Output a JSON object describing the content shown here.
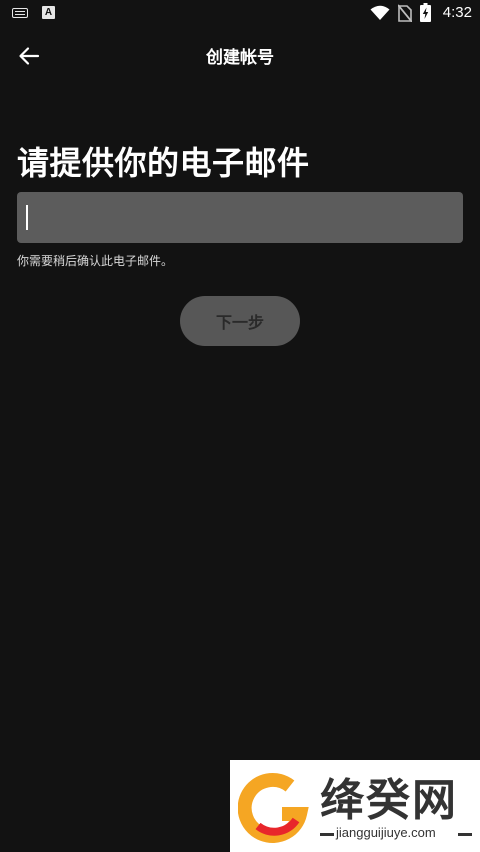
{
  "status_bar": {
    "time": "4:32",
    "left_icons": [
      "keyboard-icon",
      "a-notification-icon"
    ],
    "right_icons": [
      "wifi-icon",
      "no-sim-icon",
      "battery-charging-icon"
    ]
  },
  "app_bar": {
    "back_icon": "arrow-left-icon",
    "title": "创建帐号"
  },
  "form": {
    "heading": "请提供你的电子邮件",
    "email_value": "",
    "hint": "你需要稍后确认此电子邮件。",
    "next_label": "下一步"
  },
  "watermark": {
    "brand": "绛癸网",
    "url": "jiangguijiuye.com"
  },
  "colors": {
    "background": "#121212",
    "input_bg": "#5c5c5c",
    "button_bg": "#575757",
    "logo_orange": "#f5a623",
    "logo_red": "#e8262b"
  }
}
